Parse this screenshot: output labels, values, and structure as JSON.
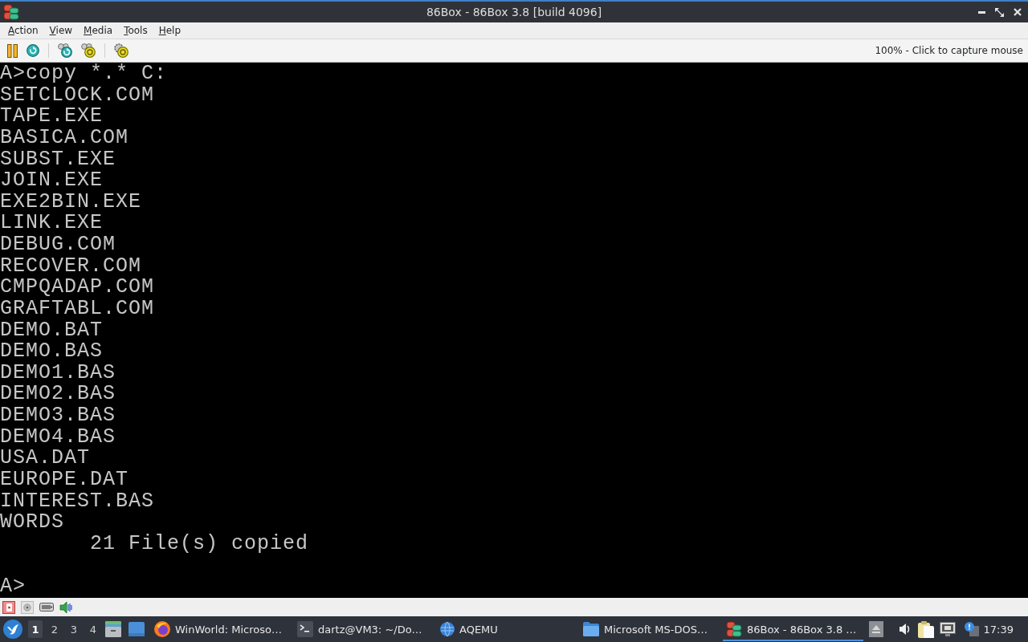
{
  "window": {
    "title": "86Box - 86Box 3.8 [build 4096]"
  },
  "menu_bar": {
    "items": [
      {
        "label": "Action"
      },
      {
        "label": "View"
      },
      {
        "label": "Media"
      },
      {
        "label": "Tools"
      },
      {
        "label": "Help"
      }
    ]
  },
  "toolbar": {
    "status_text": "100% - Click to capture mouse"
  },
  "screen": {
    "lines": [
      {
        "kind": "command",
        "text": "A>copy *.* C:"
      },
      {
        "kind": "output",
        "text": "SETCLOCK.COM"
      },
      {
        "kind": "output",
        "text": "TAPE.EXE"
      },
      {
        "kind": "output",
        "text": "BASICA.COM"
      },
      {
        "kind": "output",
        "text": "SUBST.EXE"
      },
      {
        "kind": "output",
        "text": "JOIN.EXE"
      },
      {
        "kind": "output",
        "text": "EXE2BIN.EXE"
      },
      {
        "kind": "output",
        "text": "LINK.EXE"
      },
      {
        "kind": "output",
        "text": "DEBUG.COM"
      },
      {
        "kind": "output",
        "text": "RECOVER.COM"
      },
      {
        "kind": "output",
        "text": "CMPQADAP.COM"
      },
      {
        "kind": "output",
        "text": "GRAFTABL.COM"
      },
      {
        "kind": "output",
        "text": "DEMO.BAT"
      },
      {
        "kind": "output",
        "text": "DEMO.BAS"
      },
      {
        "kind": "output",
        "text": "DEMO1.BAS"
      },
      {
        "kind": "output",
        "text": "DEMO2.BAS"
      },
      {
        "kind": "output",
        "text": "DEMO3.BAS"
      },
      {
        "kind": "output",
        "text": "DEMO4.BAS"
      },
      {
        "kind": "output",
        "text": "USA.DAT"
      },
      {
        "kind": "output",
        "text": "EUROPE.DAT"
      },
      {
        "kind": "output",
        "text": "INTEREST.BAS"
      },
      {
        "kind": "output",
        "text": "WORDS"
      },
      {
        "kind": "summary",
        "text": "21 File(s) copied"
      },
      {
        "kind": "prompt",
        "text": "A>"
      }
    ]
  },
  "taskbar": {
    "workspaces": [
      {
        "label": "1",
        "selected": true
      },
      {
        "label": "2",
        "selected": false
      },
      {
        "label": "3",
        "selected": false
      },
      {
        "label": "4",
        "selected": false
      }
    ],
    "tasks": [
      {
        "label": "WinWorld: Microso…",
        "selected": false
      },
      {
        "label": "dartz@VM3: ~/Do…",
        "selected": false
      },
      {
        "label": "AQEMU",
        "selected": false
      },
      {
        "label": "Microsoft MS-DOS…",
        "selected": false
      },
      {
        "label": "86Box - 86Box 3.8 …",
        "selected": true
      }
    ],
    "clock": "17:39"
  }
}
